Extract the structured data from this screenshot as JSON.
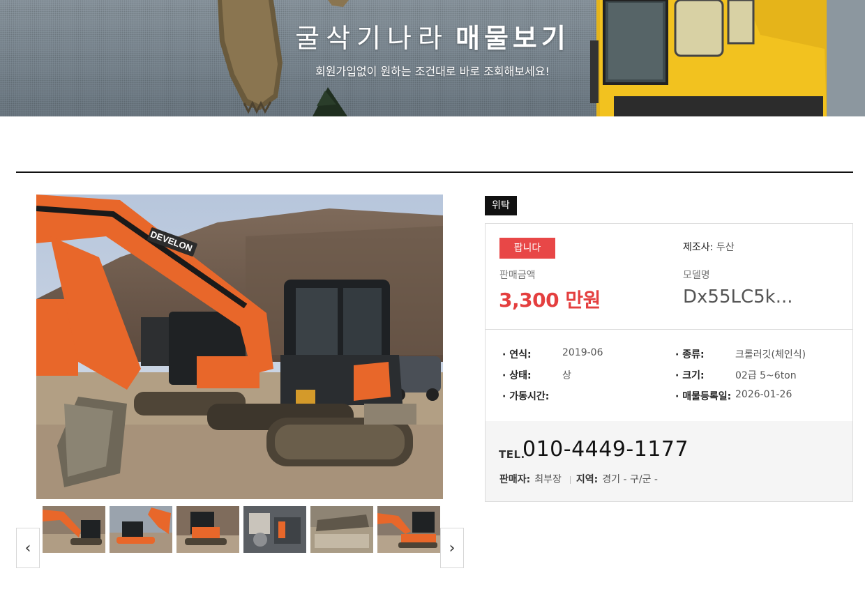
{
  "banner": {
    "title_light": "굴삭기나라",
    "title_bold": "매물보기",
    "subtitle": "회원가입없이 원하는 조건대로 바로 조회해보세요!"
  },
  "listing": {
    "tag": "위탁",
    "status": "팝니다",
    "maker_label": "제조사:",
    "maker": "두산",
    "price_label": "판매금액",
    "price": "3,300 만원",
    "model_label": "모델명",
    "model": "Dx55LC5k...",
    "specs": {
      "year_label": "· 연식:",
      "year": "2019-06",
      "type_label": "· 종류:",
      "type": "크롤러깃(체인식)",
      "condition_label": "· 상태:",
      "condition": "상",
      "size_label": "· 크기:",
      "size": "02급 5~6ton",
      "hours_label": "· 가동시간:",
      "hours": "",
      "registered_label": "· 매물등록일:",
      "registered": "2026-01-26"
    },
    "contact": {
      "tel_label": "TEL.",
      "tel": "010-4449-1177",
      "seller_label": "판매자:",
      "seller": "최부장",
      "region_label": "지역:",
      "region": "경기 - 구/군 -"
    }
  },
  "gallery": {
    "main_brand_text": "DEVELON",
    "prev_icon": "chevron-left-icon",
    "next_icon": "chevron-right-icon",
    "prev_glyph": "‹",
    "next_glyph": "›",
    "thumbnail_count": 6
  },
  "colors": {
    "accent_red": "#e84747",
    "price_red": "#e43f3f",
    "machine_orange": "#e8672a"
  }
}
